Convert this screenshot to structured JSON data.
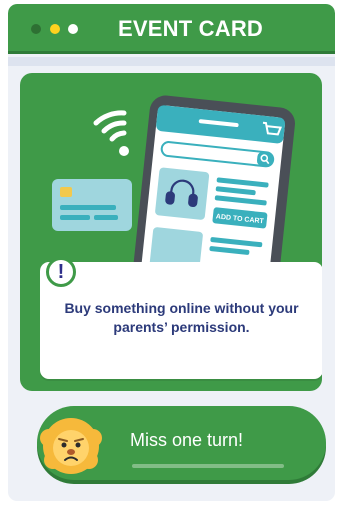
{
  "header": {
    "title": "EVENT CARD",
    "dot_colors": [
      "#2e7033",
      "#ffd21f",
      "#ffffff"
    ]
  },
  "event": {
    "message": "Buy something online without your parents’ permission.",
    "phone_button_label": "ADD TO CART",
    "icons": [
      "wifi-icon",
      "credit-card-icon",
      "smartphone-icon",
      "headphones-icon",
      "shopping-cart-icon",
      "search-icon",
      "exclamation-icon"
    ]
  },
  "action": {
    "label": "Miss one turn!",
    "mascot": "sad-lion-icon"
  },
  "colors": {
    "green": "#3f9a48",
    "dark_green": "#2f7b38",
    "text_navy": "#2c3a7a",
    "teal": "#3ab0bd",
    "yellow": "#ffd21f"
  }
}
